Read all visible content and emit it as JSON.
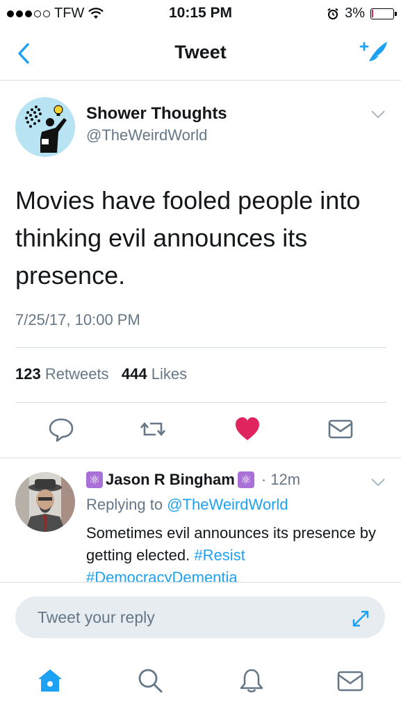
{
  "status_bar": {
    "carrier": "TFW",
    "time": "10:15 PM",
    "battery": "3%",
    "battery_level": 0.03,
    "signal_bars": 3,
    "icons": [
      "signal-dots-icon",
      "wifi-icon",
      "alarm-icon",
      "battery-icon"
    ]
  },
  "nav": {
    "title": "Tweet",
    "back_icon": "chevron-left-icon",
    "compose_icon": "compose-quill-icon"
  },
  "tweet": {
    "author_name": "Shower Thoughts",
    "author_handle": "@TheWeirdWorld",
    "text": "Movies have fooled people into thinking evil announces its presence.",
    "date": "7/25/17, 10:00 PM",
    "retweet_count": "123",
    "retweet_label": "Retweets",
    "like_count": "444",
    "like_label": "Likes",
    "liked": true
  },
  "reply": {
    "name": "Jason R Bingham",
    "time": "· 12m",
    "replying_prefix": "Replying to",
    "replying_handle": "@TheWeirdWorld",
    "text": "Sometimes evil announces its presence by getting elected.",
    "hashtags": "#Resist #DemocracyDementia"
  },
  "reply_box": {
    "placeholder": "Tweet your reply"
  },
  "colors": {
    "accent": "#1da1f2",
    "like": "#e0245e",
    "text": "#14171a",
    "secondary": "#657786",
    "divider": "#d8dde0"
  }
}
